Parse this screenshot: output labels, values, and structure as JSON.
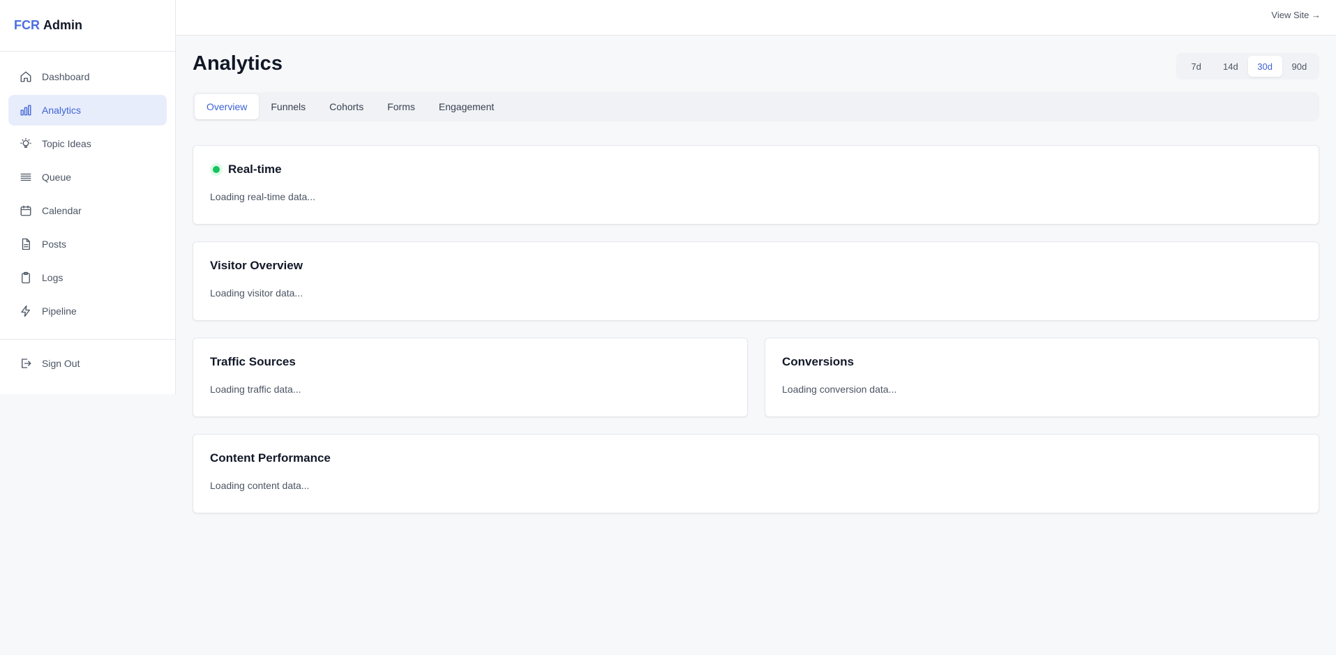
{
  "brand": {
    "accent": "FCR",
    "rest": "Admin"
  },
  "sidebar": {
    "items": [
      {
        "label": "Dashboard",
        "icon": "home-icon"
      },
      {
        "label": "Analytics",
        "icon": "bar-chart-icon"
      },
      {
        "label": "Topic Ideas",
        "icon": "lightbulb-icon"
      },
      {
        "label": "Queue",
        "icon": "list-icon"
      },
      {
        "label": "Calendar",
        "icon": "calendar-icon"
      },
      {
        "label": "Posts",
        "icon": "document-icon"
      },
      {
        "label": "Logs",
        "icon": "clipboard-icon"
      },
      {
        "label": "Pipeline",
        "icon": "lightning-icon"
      }
    ],
    "active": "Analytics",
    "sign_out": {
      "label": "Sign Out",
      "icon": "sign-out-icon"
    }
  },
  "topbar": {
    "view_site": "View Site →"
  },
  "main": {
    "title": "Analytics",
    "ranges": [
      "7d",
      "14d",
      "30d",
      "90d"
    ],
    "active_range": "30d",
    "tabs": [
      "Overview",
      "Funnels",
      "Cohorts",
      "Forms",
      "Engagement"
    ],
    "active_tab": "Overview",
    "cards": {
      "realtime": {
        "title": "Real-time",
        "text": "Loading real-time data..."
      },
      "visitor": {
        "title": "Visitor Overview",
        "text": "Loading visitor data..."
      },
      "traffic": {
        "title": "Traffic Sources",
        "text": "Loading traffic data..."
      },
      "conversions": {
        "title": "Conversions",
        "text": "Loading conversion data..."
      },
      "content": {
        "title": "Content Performance",
        "text": "Loading content data..."
      }
    }
  },
  "colors": {
    "accent": "#3d63d6",
    "active_nav_bg": "#e8edfc",
    "live": "#16c25e",
    "page_bg": "#f7f8fa"
  }
}
